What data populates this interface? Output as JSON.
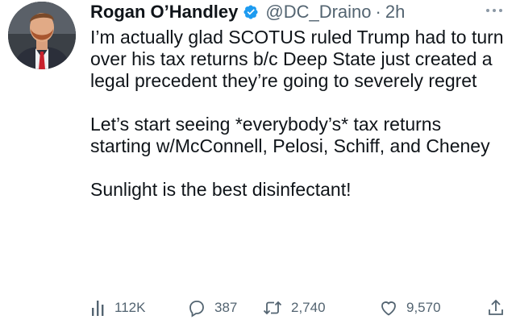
{
  "author": {
    "name": "Rogan O’Handley",
    "handle": "@DC_Draino",
    "separator": "·",
    "time": "2h",
    "verified": true
  },
  "more_icon": "more-dots-icon",
  "tweet": {
    "paragraphs": [
      "I’m actually glad SCOTUS ruled Trump had to turn over his tax returns b/c Deep State just created a legal precedent they’re going to severely regret",
      "Let’s start seeing *everybody’s* tax returns starting w/McConnell, Pelosi, Schiff, and Cheney",
      "Sunlight is the best disinfectant!"
    ]
  },
  "actions": {
    "views": {
      "icon": "analytics-icon",
      "count": "112K"
    },
    "reply": {
      "icon": "reply-icon",
      "count": "387"
    },
    "retweet": {
      "icon": "retweet-icon",
      "count": "2,740"
    },
    "like": {
      "icon": "heart-icon",
      "count": "9,570"
    },
    "share": {
      "icon": "share-icon"
    }
  },
  "colors": {
    "text": "#0f1419",
    "secondary": "#536471",
    "verified": "#1d9bf0"
  }
}
